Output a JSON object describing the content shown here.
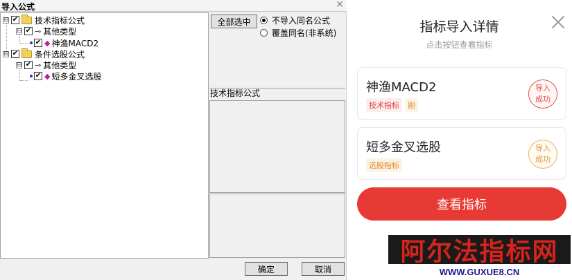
{
  "dialog": {
    "title": "导入公式",
    "close_glyph": "✕",
    "tree": {
      "root1": {
        "label": "技术指标公式",
        "expander": "⊟",
        "checked": "✔"
      },
      "root1_child": {
        "label": "其他类型",
        "expander": "⊟",
        "checked": "✔"
      },
      "root1_leaf": {
        "label": "神渔MACD2",
        "checked": "✔"
      },
      "root2": {
        "label": "条件选股公式",
        "expander": "⊟",
        "checked": "✔"
      },
      "root2_child": {
        "label": "其他类型",
        "expander": "⊟",
        "checked": "✔"
      },
      "root2_leaf": {
        "label": "短多金叉选股",
        "checked": "✔"
      }
    },
    "select_all_label": "全部选中",
    "radio_options": [
      {
        "label": "不导入同名公式",
        "selected": true
      },
      {
        "label": "覆盖同名(非系统)",
        "selected": false
      }
    ],
    "panel_label": "技术指标公式",
    "ok_label": "确定",
    "cancel_label": "取消"
  },
  "modal": {
    "title": "指标导入详情",
    "subtitle": "点击按钮查看指标",
    "cards": [
      {
        "name": "神渔MACD2",
        "tags": [
          "技术指标",
          "副"
        ],
        "stamp_line1": "导入",
        "stamp_line2": "成功",
        "color": "#e0524c"
      },
      {
        "name": "短多金叉选股",
        "tags": [
          "选股指标"
        ],
        "stamp_line1": "导入",
        "stamp_line2": "成功",
        "color": "#e09a3a"
      }
    ],
    "view_button_label": "查看指标",
    "accent": "#e83a35"
  },
  "watermark": {
    "text": "阿尔法指标网",
    "url": "WWW.GUXUE8.CN"
  }
}
